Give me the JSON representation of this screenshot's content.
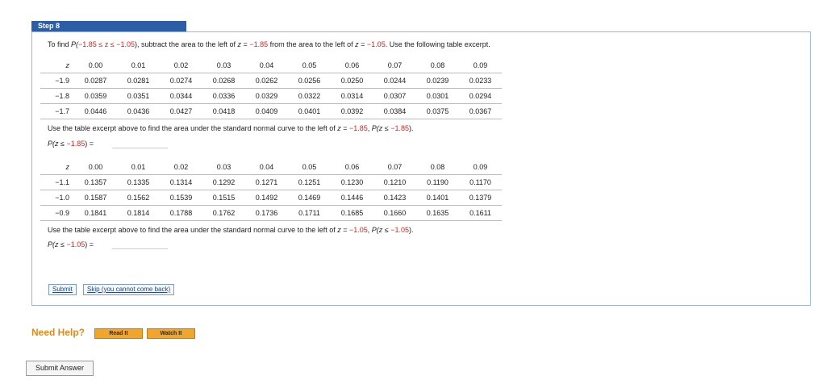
{
  "step": {
    "title": "Step 8"
  },
  "intro": {
    "p1": "To find ",
    "p2": "P(",
    "p3": "−1.85 ≤ z ≤ −1.05",
    "p4": "), subtract the area to the left of ",
    "p5": "z",
    "p6": " = ",
    "p7": "−1.85",
    "p8": " from the area to the left of ",
    "p9": "z",
    "p10": " = ",
    "p11": "−1.05",
    "p12": ". Use the following table excerpt."
  },
  "table1": {
    "header": [
      "z",
      "0.00",
      "0.01",
      "0.02",
      "0.03",
      "0.04",
      "0.05",
      "0.06",
      "0.07",
      "0.08",
      "0.09"
    ],
    "rows": [
      [
        "−1.9",
        "0.0287",
        "0.0281",
        "0.0274",
        "0.0268",
        "0.0262",
        "0.0256",
        "0.0250",
        "0.0244",
        "0.0239",
        "0.0233"
      ],
      [
        "−1.8",
        "0.0359",
        "0.0351",
        "0.0344",
        "0.0336",
        "0.0329",
        "0.0322",
        "0.0314",
        "0.0307",
        "0.0301",
        "0.0294"
      ],
      [
        "−1.7",
        "0.0446",
        "0.0436",
        "0.0427",
        "0.0418",
        "0.0409",
        "0.0401",
        "0.0392",
        "0.0384",
        "0.0375",
        "0.0367"
      ]
    ]
  },
  "q1": {
    "text1": "Use the table excerpt above to find the area under the standard normal curve to the left of ",
    "z": "z",
    "eq": " = ",
    "val": "−1.85",
    "text2": ", ",
    "p": "P(z ≤ ",
    "pval": "−1.85",
    "pend": ").",
    "label_a": "P(z ≤ ",
    "label_val": "−1.85",
    "label_end": ") ="
  },
  "table2": {
    "header": [
      "z",
      "0.00",
      "0.01",
      "0.02",
      "0.03",
      "0.04",
      "0.05",
      "0.06",
      "0.07",
      "0.08",
      "0.09"
    ],
    "rows": [
      [
        "−1.1",
        "0.1357",
        "0.1335",
        "0.1314",
        "0.1292",
        "0.1271",
        "0.1251",
        "0.1230",
        "0.1210",
        "0.1190",
        "0.1170"
      ],
      [
        "−1.0",
        "0.1587",
        "0.1562",
        "0.1539",
        "0.1515",
        "0.1492",
        "0.1469",
        "0.1446",
        "0.1423",
        "0.1401",
        "0.1379"
      ],
      [
        "−0.9",
        "0.1841",
        "0.1814",
        "0.1788",
        "0.1762",
        "0.1736",
        "0.1711",
        "0.1685",
        "0.1660",
        "0.1635",
        "0.1611"
      ]
    ]
  },
  "q2": {
    "text1": "Use the table excerpt above to find the area under the standard normal curve to the left of ",
    "z": "z",
    "eq": " = ",
    "val": "−1.05",
    "text2": ", ",
    "p": "P(z ≤ ",
    "pval": "−1.05",
    "pend": ").",
    "label_a": "P(z ≤ ",
    "label_val": "−1.05",
    "label_end": ") ="
  },
  "buttons": {
    "submit": "Submit",
    "skip": "Skip (you cannot come back)",
    "need_help": "Need Help?",
    "read_it": "Read It",
    "watch_it": "Watch It",
    "submit_answer": "Submit Answer"
  },
  "colors": {
    "header_bg": "#2b5ea6",
    "accent_red": "#d9231d",
    "help_orange": "#f0a62d"
  }
}
